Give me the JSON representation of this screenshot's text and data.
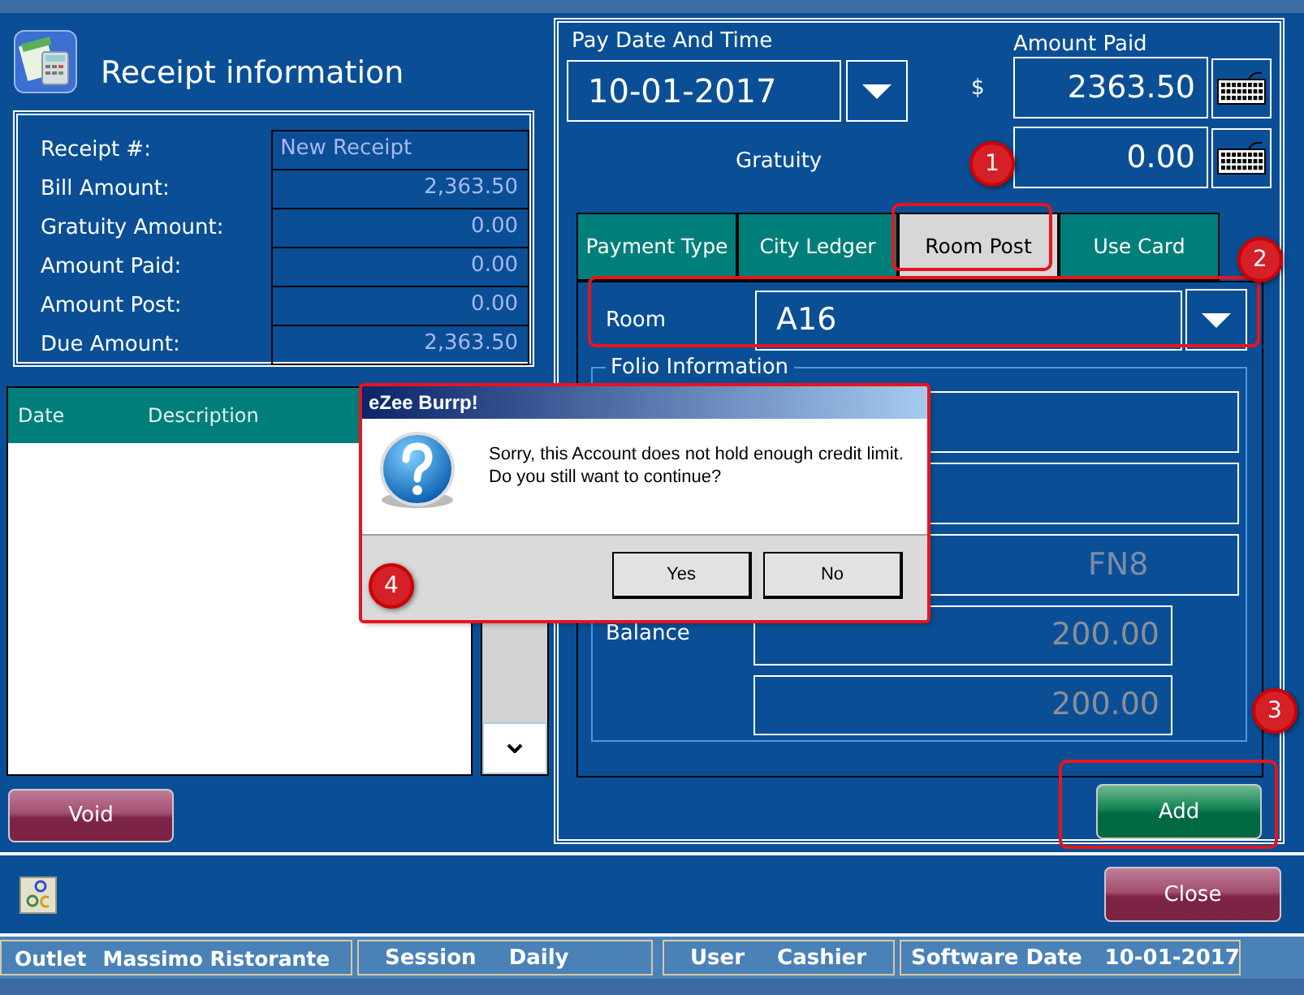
{
  "header": {
    "title": "Receipt information"
  },
  "receipt_info": [
    {
      "label": "Receipt #:",
      "value": "New Receipt"
    },
    {
      "label": "Bill Amount:",
      "value": "2,363.50"
    },
    {
      "label": "Gratuity Amount:",
      "value": "0.00"
    },
    {
      "label": "Amount Paid:",
      "value": "0.00"
    },
    {
      "label": "Amount Post:",
      "value": "0.00"
    },
    {
      "label": "Due Amount:",
      "value": "2,363.50"
    }
  ],
  "list": {
    "columns": [
      "Date",
      "Description"
    ]
  },
  "void_button": "Void",
  "payment": {
    "pay_date_label": "Pay Date And Time",
    "pay_date": "10-01-2017",
    "amount_paid_label": "Amount Paid",
    "currency": "$",
    "amount_paid": "2363.50",
    "gratuity_label": "Gratuity",
    "gratuity": "0.00"
  },
  "tabs": [
    {
      "label": "Payment Type",
      "selected": false
    },
    {
      "label": "City Ledger",
      "selected": false
    },
    {
      "label": "Room Post",
      "selected": true
    },
    {
      "label": "Use Card",
      "selected": false
    }
  ],
  "room": {
    "label": "Room",
    "value": "A16"
  },
  "folio": {
    "title": "Folio Information",
    "partial_value": "FN8",
    "balance_label": "Balance",
    "balance_values": [
      "200.00",
      "200.00"
    ]
  },
  "add_button": "Add",
  "close_button": "Close",
  "status_bar": [
    {
      "label": "Outlet",
      "value": "Massimo Ristorante"
    },
    {
      "label": "Session",
      "value": "Daily"
    },
    {
      "label": "User",
      "value": "Cashier"
    },
    {
      "label": "Software Date",
      "value": "10-01-2017"
    }
  ],
  "dialog": {
    "title": "eZee Burrp!",
    "message": [
      "Sorry, this Account does not hold enough credit limit.",
      "Do you still want to continue?"
    ],
    "buttons": [
      "Yes",
      "No"
    ]
  },
  "annotations": [
    {
      "label": "1"
    },
    {
      "label": "2"
    },
    {
      "label": "3"
    },
    {
      "label": "4"
    }
  ]
}
